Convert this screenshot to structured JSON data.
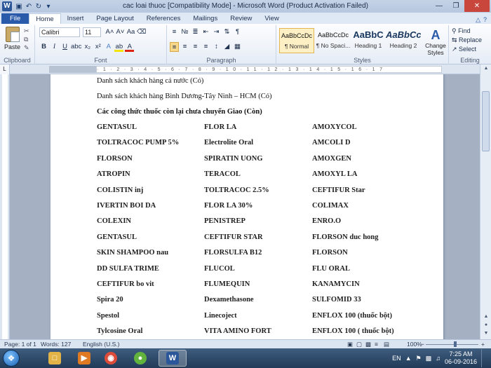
{
  "window": {
    "title": "cac loai thuoc [Compatibility Mode] - Microsoft Word (Product Activation Failed)"
  },
  "tabs": [
    "File",
    "Home",
    "Insert",
    "Page Layout",
    "References",
    "Mailings",
    "Review",
    "View"
  ],
  "ribbon": {
    "clipboard": {
      "paste": "Paste",
      "label": "Clipboard"
    },
    "font": {
      "name": "Calibri",
      "size": "11",
      "label": "Font"
    },
    "paragraph": {
      "label": "Paragraph"
    },
    "styles": {
      "label": "Styles",
      "items": [
        {
          "preview": "AaBbCcDc",
          "name": "¶ Normal"
        },
        {
          "preview": "AaBbCcDc",
          "name": "¶ No Spaci..."
        },
        {
          "preview": "AaBbC",
          "name": "Heading 1"
        },
        {
          "preview": "AaBbCc",
          "name": "Heading 2"
        }
      ],
      "change_styles": "Change Styles"
    },
    "editing": {
      "label": "Editing",
      "find": "Find",
      "replace": "Replace",
      "select": "Select"
    }
  },
  "document": {
    "lines": [
      "Danh sách khách hàng cá nước (Có)",
      "Danh sách khách hàng Bình Dương-Tây Ninh – HCM (Có)",
      "Các công thức thuốc còn lại chưa chuyển Giao (Còn)"
    ],
    "rows": [
      [
        "GENTASUL",
        "FLOR LA",
        "AMOXYCOL"
      ],
      [
        "TOLTRACOC PUMP 5%",
        "Electrolite Oral",
        "AMCOLI D"
      ],
      [
        "FLORSON",
        "SPIRATIN UONG",
        "AMOXGEN"
      ],
      [
        "ATROPIN",
        "TERACOL",
        "AMOXYL LA"
      ],
      [
        "COLISTIN inj",
        "TOLTRACOC 2.5%",
        "CEFTIFUR Star"
      ],
      [
        "IVERTIN BOI DA",
        "FLOR LA 30%",
        "COLIMAX"
      ],
      [
        "COLEXIN",
        "PENISTREP",
        "ENRO.O"
      ],
      [
        "GENTASUL",
        "CEFTIFUR STAR",
        "FLORSON duc hong"
      ],
      [
        "SKIN SHAMPOO nau",
        "FLORSULFA B12",
        "FLORSON"
      ],
      [
        "DD SULFA TRIME",
        "FLUCOL",
        "FLU ORAL"
      ],
      [
        "CEFTIFUR bo vit",
        "FLUMEQUIN",
        "KANAMYCIN"
      ],
      [
        "Spira 20",
        "Dexamethasone",
        "SULFOMID 33"
      ],
      [
        "Spestol",
        "Linecoject",
        "ENFLOX 100 (thuốc bột)"
      ],
      [
        "Tylcosine Oral",
        "VITA AMINO FORT",
        "ENFLOX 100 ( thuốc bột)"
      ]
    ]
  },
  "status": {
    "page": "Page: 1 of 1",
    "words": "Words: 127",
    "language": "English (U.S.)",
    "zoom": "100%"
  },
  "taskbar": {
    "language": "EN",
    "time": "7:25 AM",
    "date": "06-09-2016"
  }
}
